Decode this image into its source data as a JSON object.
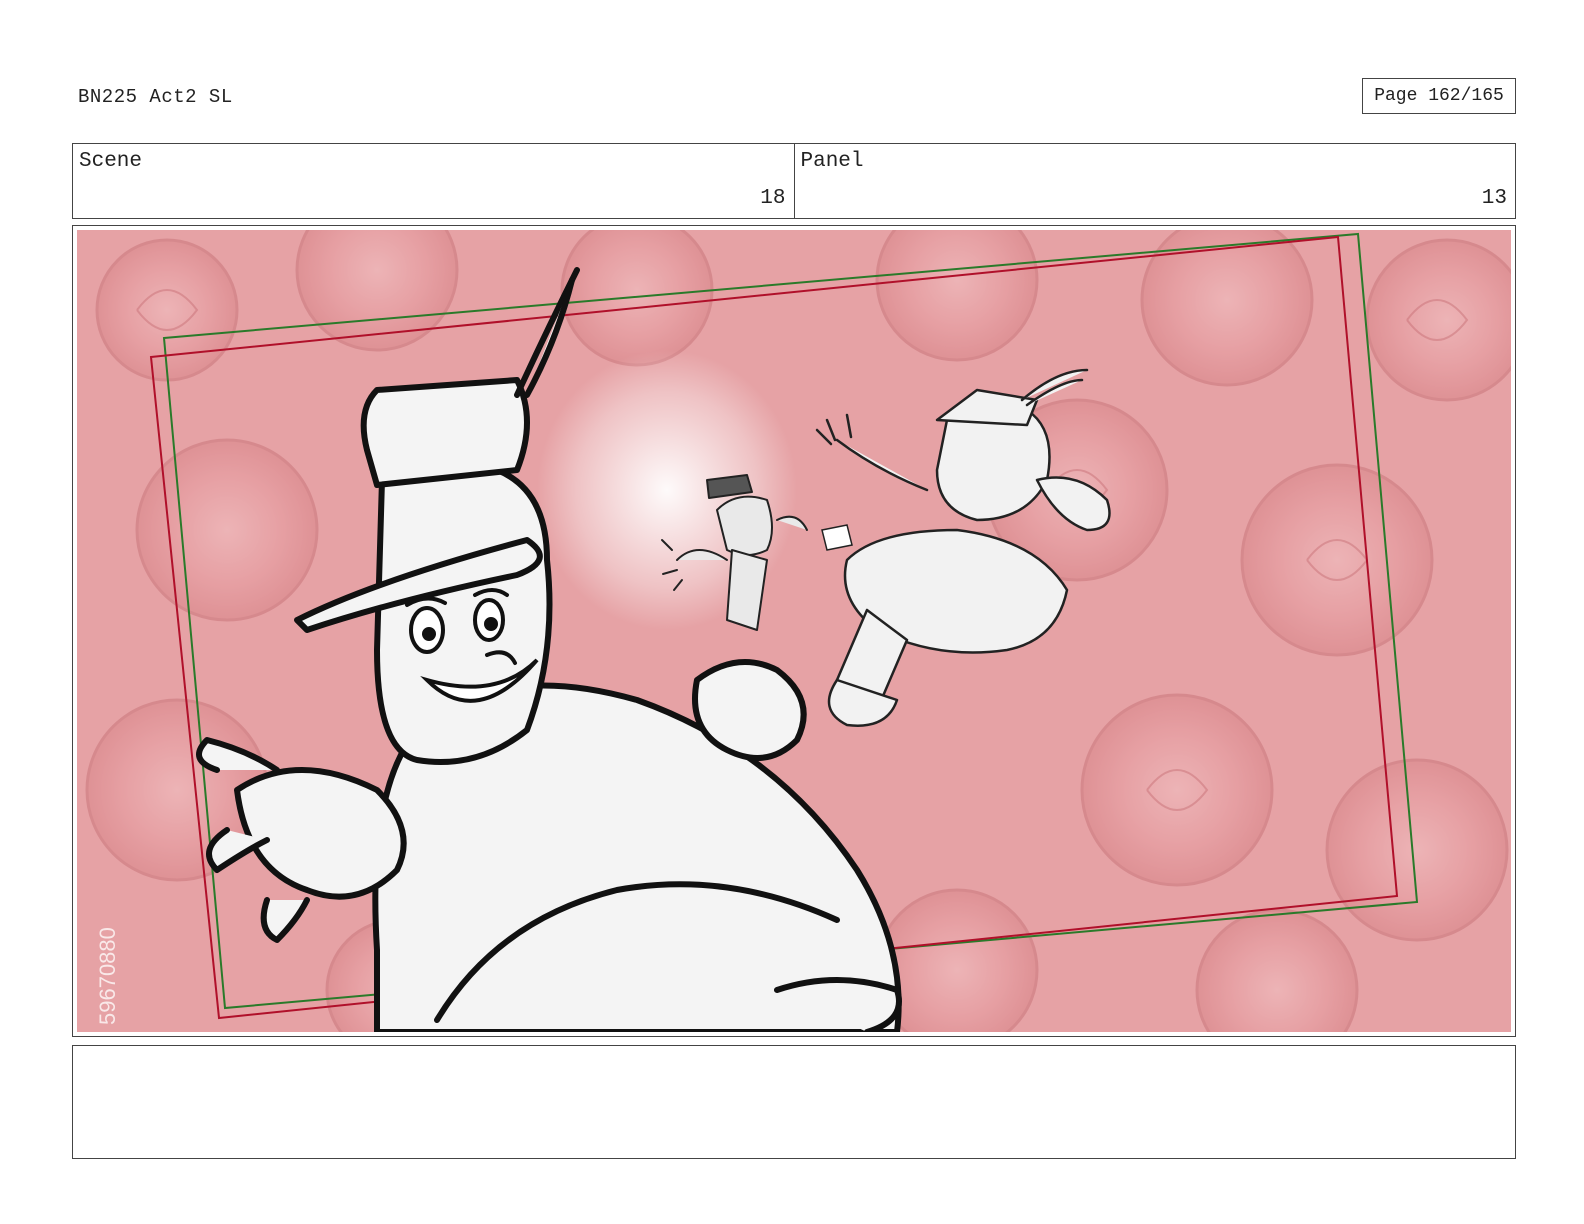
{
  "header": {
    "doc_title": "BN225 Act2 SL",
    "page_label": "Page 162/165"
  },
  "scene": {
    "label": "Scene",
    "value": "18"
  },
  "panel": {
    "label": "Panel",
    "value": "13"
  },
  "artwork": {
    "description_icon": "storyboard-drawing",
    "watermark_text": "59670880",
    "colors": {
      "rose_background": "#e8a3a6",
      "safe_frame_red": "#b0102a",
      "safe_frame_green": "#2a7a2a",
      "ink": "#111111"
    }
  },
  "notes": {
    "text": ""
  }
}
